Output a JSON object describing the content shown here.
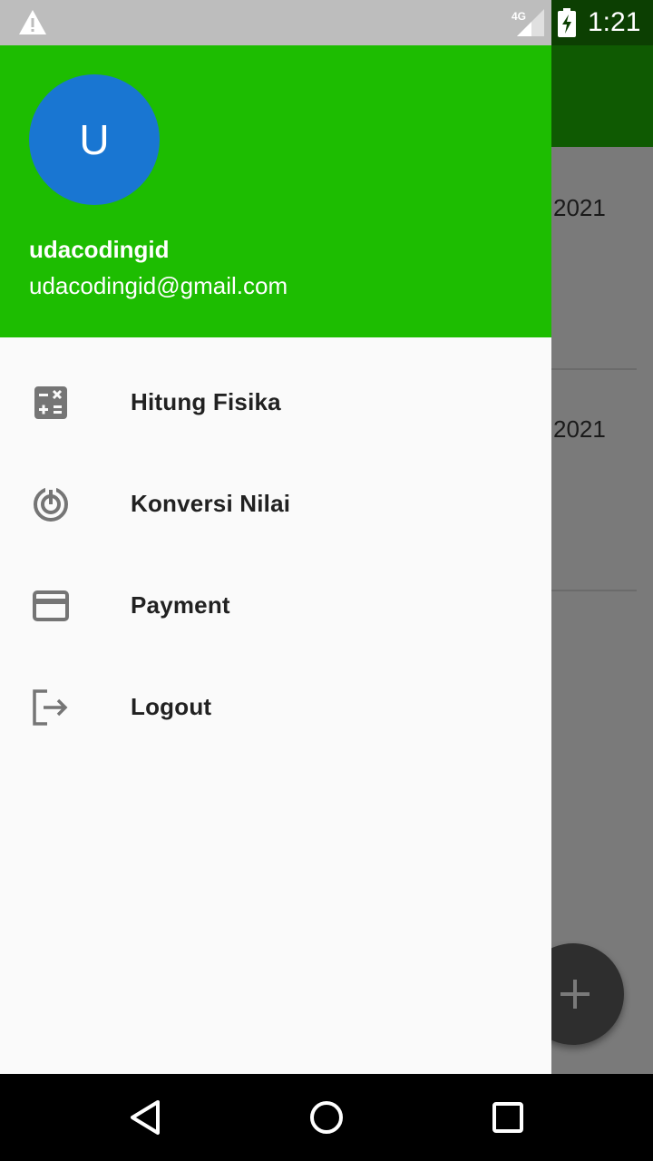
{
  "status_bar": {
    "time": "1:21",
    "network_label": "4G",
    "icons": [
      "warning-icon",
      "cellular-signal-icon",
      "battery-charging-icon"
    ]
  },
  "background": {
    "list_dates": [
      "2021",
      "2021"
    ],
    "fab_icon": "add-icon"
  },
  "drawer": {
    "header": {
      "avatar_initial": "U",
      "account_name": "udacodingid",
      "account_email": "udacodingid@gmail.com",
      "color": "#1dbd01"
    },
    "items": [
      {
        "label": "Hitung Fisika",
        "icon": "calculator-icon"
      },
      {
        "label": "Konversi Nilai",
        "icon": "radar-icon"
      },
      {
        "label": "Payment",
        "icon": "credit-card-icon"
      },
      {
        "label": "Logout",
        "icon": "logout-icon"
      }
    ]
  },
  "nav_bar": {
    "icons": [
      "back-icon",
      "home-icon",
      "recent-apps-icon"
    ]
  },
  "colors": {
    "appbar": "#0f5a02",
    "avatar": "#1976d2",
    "scrim": "#7a7a7a"
  }
}
